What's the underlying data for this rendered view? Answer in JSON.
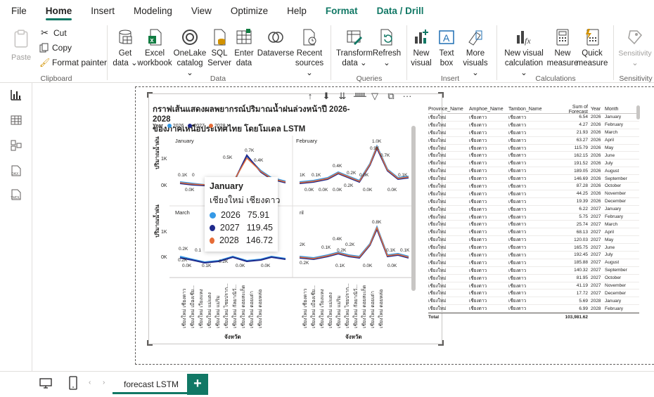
{
  "menu": {
    "items": [
      "File",
      "Home",
      "Insert",
      "Modeling",
      "View",
      "Optimize",
      "Help",
      "Format",
      "Data / Drill"
    ],
    "active": "Home"
  },
  "ribbon": {
    "clipboard": {
      "paste": "Paste",
      "cut": "Cut",
      "copy": "Copy",
      "format_painter": "Format painter",
      "label": "Clipboard"
    },
    "data": {
      "get_data": [
        "Get",
        "data ⌄"
      ],
      "excel": [
        "Excel",
        "workbook"
      ],
      "onelake": [
        "OneLake",
        "catalog ⌄"
      ],
      "sql": [
        "SQL",
        "Server"
      ],
      "enter": [
        "Enter",
        "data"
      ],
      "dataverse": [
        "Dataverse",
        ""
      ],
      "recent": [
        "Recent",
        "sources ⌄"
      ],
      "label": "Data"
    },
    "queries": {
      "transform": [
        "Transform",
        "data ⌄"
      ],
      "refresh": [
        "Refresh",
        "⌄"
      ],
      "label": "Queries"
    },
    "insert": {
      "new_visual": [
        "New",
        "visual"
      ],
      "text_box": [
        "Text",
        "box"
      ],
      "more_visuals": [
        "More",
        "visuals ⌄"
      ],
      "label": "Insert"
    },
    "calculations": {
      "new_visual_calc": [
        "New visual",
        "calculation ⌄"
      ],
      "new_measure": [
        "New",
        "measure"
      ],
      "quick_measure": [
        "Quick",
        "measure"
      ],
      "label": "Calculations"
    },
    "sensitivity": {
      "button": [
        "Sensitivity",
        "⌄"
      ],
      "label": "Sensitivity"
    }
  },
  "visual": {
    "title_line1": "กราฟเส้นแสดงผลพยากรณ์ปริมาณน้ำฝนล่วงหน้าปี 2026-2028",
    "title_line2": "ของภาคเหนือประเทศไทย โดยโมเดล LSTM",
    "legend_title": "Year",
    "legend": [
      {
        "name": "2026",
        "color": "#3599e6"
      },
      {
        "name": "2027",
        "color": "#1f2a8c"
      },
      {
        "name": "2028",
        "color": "#e66c37"
      }
    ],
    "panels": [
      "January",
      "February",
      "March",
      "ril"
    ],
    "y_axis_title": "ปริมาณน้ำฝน",
    "x_axis_title": "จังหวัด",
    "y_ticks": [
      "1K",
      "0K"
    ],
    "data_labels": {
      "jan": [
        "0.5K",
        "0.7K",
        "0.4K",
        "0.1K",
        "0",
        "0.0K"
      ],
      "feb": [
        "1.0K",
        "0.9K",
        "0.7K",
        "0.4K",
        "0.2K",
        "1K",
        "0.1K",
        "0.0K",
        "0.1K",
        "0.0K",
        "0.0K",
        "0.0K",
        "0.2K",
        "0.0K",
        "0.0K"
      ],
      "mar": [
        "0.2K",
        "0.1",
        "0.2K",
        "0.1K",
        "0.2K",
        "0.0K",
        "0.0K",
        "0.0K"
      ],
      "apr": [
        "0.8K",
        "0.4K",
        "0.2K",
        "2K",
        "0.1K",
        "0.2K",
        "0.1K",
        "0.1K",
        "0.2K",
        "0.1K",
        "0.0K",
        "0.0K"
      ]
    },
    "x_categories": [
      "เชียงใหม่ เชียงดาว",
      "เชียงใหม่ เมืองเชีย...",
      "เชียงใหม่ เวียงแหง",
      "เชียงใหม่ แม่แตง",
      "เชียงใหม่ แม่ริม",
      "เชียงใหม่ ไชยปราก...",
      "เชียงใหม่ กัลยาณิวั...",
      "เชียงใหม่ ดอยสะเก็ด",
      "เชียงใหม่ ดอยเต่า",
      "เชียงใหม่ ดอยหล่อ"
    ],
    "toolbar_icons": [
      "arrow-up-icon",
      "drill-down-icon",
      "expand-level-icon",
      "expand-all-icon",
      "filter-icon",
      "focus-mode-icon",
      "more-options-icon"
    ]
  },
  "tooltip": {
    "title": "January",
    "subtitle": "เชียงใหม่ เชียงดาว",
    "rows": [
      {
        "year": "2026",
        "value": "75.91",
        "color": "#3599e6"
      },
      {
        "year": "2027",
        "value": "119.45",
        "color": "#1f2a8c"
      },
      {
        "year": "2028",
        "value": "146.72",
        "color": "#e66c37"
      }
    ]
  },
  "table": {
    "headers": [
      "Province_Name",
      "Amphoe_Name",
      "Tambon_Name",
      "Sum of Forecast",
      "Year",
      "Month"
    ],
    "province": "เชียงใหม่",
    "amphoe": "เชียงดาว",
    "tambon": "เชียงดาว",
    "rows": [
      [
        "6.54",
        "2026",
        "January"
      ],
      [
        "4.27",
        "2026",
        "February"
      ],
      [
        "21.93",
        "2026",
        "March"
      ],
      [
        "63.27",
        "2026",
        "April"
      ],
      [
        "115.79",
        "2026",
        "May"
      ],
      [
        "162.15",
        "2026",
        "June"
      ],
      [
        "191.52",
        "2026",
        "July"
      ],
      [
        "189.05",
        "2026",
        "August"
      ],
      [
        "146.69",
        "2026",
        "September"
      ],
      [
        "87.28",
        "2026",
        "October"
      ],
      [
        "44.25",
        "2026",
        "November"
      ],
      [
        "19.39",
        "2026",
        "December"
      ],
      [
        "6.22",
        "2027",
        "January"
      ],
      [
        "5.75",
        "2027",
        "February"
      ],
      [
        "25.74",
        "2027",
        "March"
      ],
      [
        "68.13",
        "2027",
        "April"
      ],
      [
        "120.03",
        "2027",
        "May"
      ],
      [
        "165.75",
        "2027",
        "June"
      ],
      [
        "192.45",
        "2027",
        "July"
      ],
      [
        "185.88",
        "2027",
        "August"
      ],
      [
        "140.32",
        "2027",
        "September"
      ],
      [
        "81.95",
        "2027",
        "October"
      ],
      [
        "41.19",
        "2027",
        "November"
      ],
      [
        "17.72",
        "2027",
        "December"
      ],
      [
        "5.69",
        "2028",
        "January"
      ],
      [
        "6.99",
        "2028",
        "February"
      ]
    ],
    "total_label": "Total",
    "total_value": "103,981.62"
  },
  "bottom": {
    "page_tab": "forecast LSTM",
    "add_tab": "+"
  },
  "colors": {
    "accent": "#117865",
    "s2026": "#3599e6",
    "s2027": "#1f2a8c",
    "s2028": "#e66c37"
  }
}
